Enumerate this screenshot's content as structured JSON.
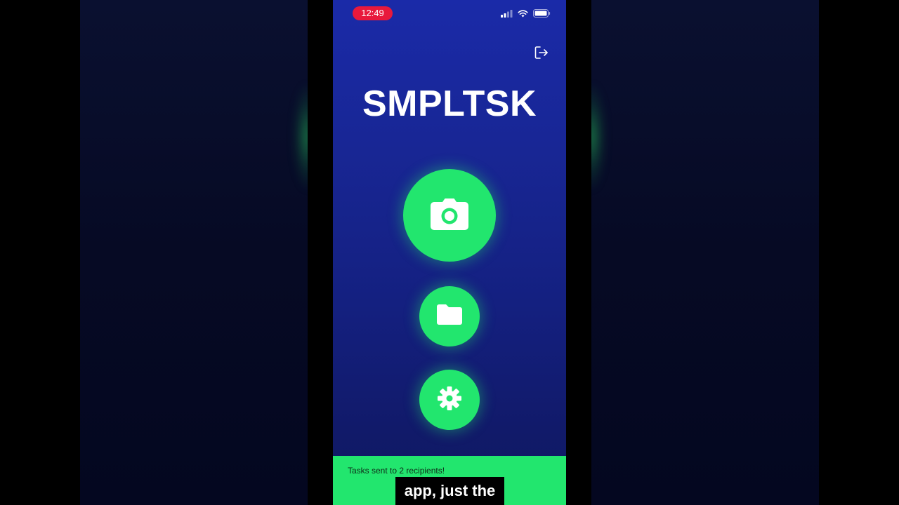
{
  "status_bar": {
    "time": "12:49",
    "time_pill_color": "#e8193c",
    "icons": [
      "cellular-signal-icon",
      "wifi-icon",
      "battery-icon"
    ]
  },
  "header": {
    "logout_icon": "logout-icon"
  },
  "app": {
    "title": "SMPLTSK",
    "accent_color": "#22e66e"
  },
  "actions": [
    {
      "name": "camera",
      "icon": "camera-icon"
    },
    {
      "name": "folder",
      "icon": "folder-icon"
    },
    {
      "name": "settings",
      "icon": "gear-icon"
    }
  ],
  "toast": {
    "message": "Tasks sent to 2 recipients!"
  },
  "video_caption": {
    "text": "app, just the"
  }
}
